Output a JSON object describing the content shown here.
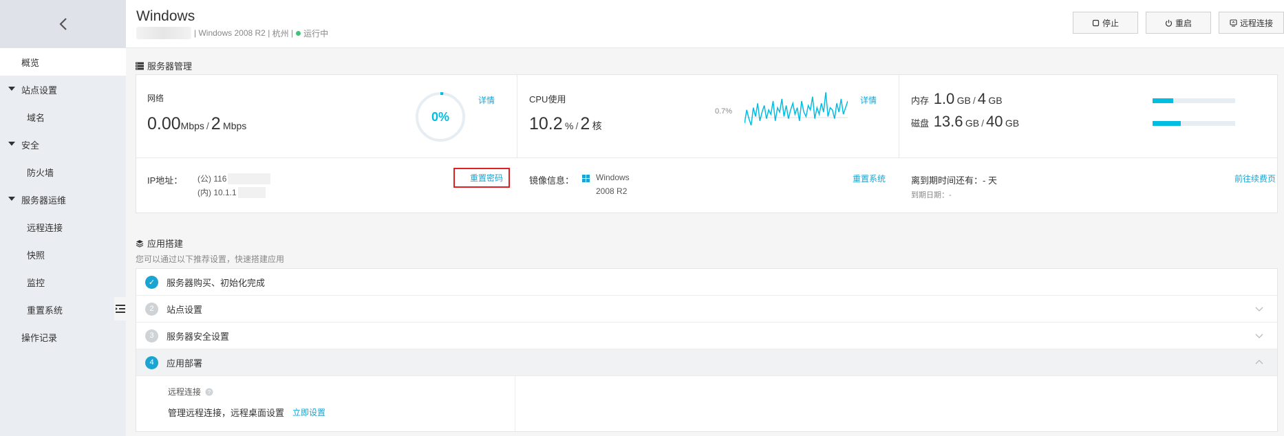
{
  "sidebar": {
    "items": [
      {
        "label": "概览",
        "kind": "top",
        "active": true
      },
      {
        "label": "站点设置",
        "kind": "group"
      },
      {
        "label": "域名",
        "kind": "child"
      },
      {
        "label": "安全",
        "kind": "group"
      },
      {
        "label": "防火墙",
        "kind": "child"
      },
      {
        "label": "服务器运维",
        "kind": "group"
      },
      {
        "label": "远程连接",
        "kind": "child"
      },
      {
        "label": "快照",
        "kind": "child"
      },
      {
        "label": "监控",
        "kind": "child"
      },
      {
        "label": "重置系统",
        "kind": "child"
      },
      {
        "label": "操作记录",
        "kind": "top"
      }
    ]
  },
  "header": {
    "title": "Windows",
    "os": "Windows 2008 R2",
    "region": "杭州",
    "status": "运行中",
    "sep": "|",
    "buttons": {
      "stop": "停止",
      "restart": "重启",
      "remote": "远程连接"
    }
  },
  "server_mgmt": {
    "title": "服务器管理",
    "network": {
      "label": "网络",
      "current": "0.00",
      "current_unit": "Mbps",
      "max": "2",
      "max_unit": "Mbps",
      "gauge_text": "0%",
      "gauge_pct": 0.02,
      "detail_link": "详情"
    },
    "cpu": {
      "label": "CPU使用",
      "value": "10.2",
      "value_unit": "%",
      "cores": "2",
      "cores_unit": "核",
      "max_label": "0.7%",
      "detail_link": "详情",
      "spark": [
        0.25,
        0.55,
        0.35,
        0.2,
        0.6,
        0.4,
        0.7,
        0.3,
        0.5,
        0.65,
        0.35,
        0.55,
        0.45,
        0.75,
        0.3,
        0.6,
        0.5,
        0.8,
        0.4,
        0.65,
        0.35,
        0.55,
        0.7,
        0.45,
        0.6,
        0.3,
        0.75,
        0.5,
        0.4,
        0.65,
        0.55,
        0.85,
        0.35,
        0.6,
        0.45,
        0.7,
        0.5,
        0.95,
        0.4,
        0.6,
        0.55,
        0.35,
        0.7,
        0.5,
        0.8,
        0.45,
        0.6,
        0.75
      ]
    },
    "memory": {
      "label": "内存",
      "used": "1.0",
      "used_unit": "GB",
      "total": "4",
      "total_unit": "GB",
      "pct": 0.25
    },
    "disk": {
      "label": "磁盘",
      "used": "13.6",
      "used_unit": "GB",
      "total": "40",
      "total_unit": "GB",
      "pct": 0.34
    },
    "ip": {
      "label": "IP地址：",
      "public": "(公) 116",
      "private": "(内) 10.1.1",
      "reset_pwd": "重置密码"
    },
    "image": {
      "label": "镜像信息：",
      "line1": "Windows",
      "line2": "2008 R2",
      "reset_sys": "重置系统"
    },
    "expiry": {
      "label": "离到期时间还有：- 天",
      "date": "到期日期：-",
      "renew": "前往续费页"
    }
  },
  "app_build": {
    "title": "应用搭建",
    "subtitle": "您可以通过以下推荐设置，快速搭建应用",
    "steps": [
      {
        "num": "✓",
        "label": "服务器购买、初始化完成",
        "state": "done"
      },
      {
        "num": "2",
        "label": "站点设置",
        "state": "todo"
      },
      {
        "num": "3",
        "label": "服务器安全设置",
        "state": "todo"
      },
      {
        "num": "4",
        "label": "应用部署",
        "state": "active"
      }
    ],
    "deploy": {
      "section": "远程连接",
      "desc": "管理远程连接，远程桌面设置",
      "action": "立即设置"
    }
  }
}
